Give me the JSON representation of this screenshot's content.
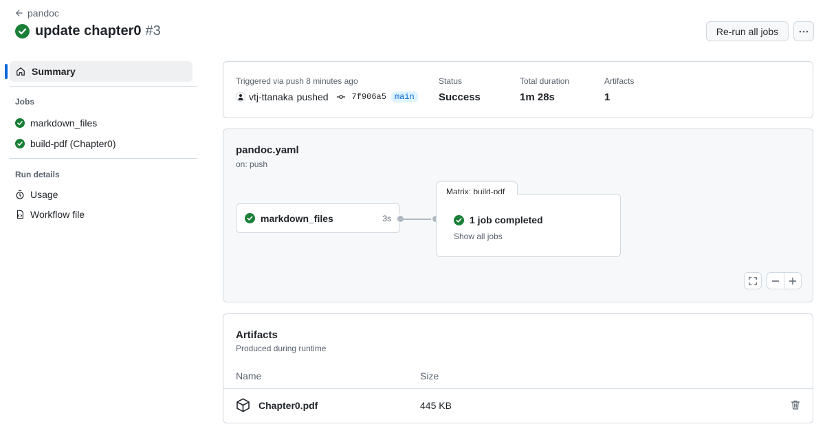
{
  "header": {
    "back_label": "pandoc",
    "run_title": "update chapter0",
    "run_number": "#3",
    "rerun_label": "Re-run all jobs",
    "more_icon": "kebab-horizontal-icon"
  },
  "sidebar": {
    "summary_label": "Summary",
    "jobs_heading": "Jobs",
    "jobs": [
      {
        "label": "markdown_files"
      },
      {
        "label": "build-pdf (Chapter0)"
      }
    ],
    "run_details_heading": "Run details",
    "run_details": [
      {
        "label": "Usage",
        "icon": "stopwatch-icon"
      },
      {
        "label": "Workflow file",
        "icon": "file-code-icon"
      }
    ]
  },
  "summary": {
    "trigger_label": "Triggered via push 8 minutes ago",
    "actor": "vtj-ttanaka",
    "action": "pushed",
    "commit": "7f906a5",
    "branch": "main",
    "status_label": "Status",
    "status_value": "Success",
    "duration_label": "Total duration",
    "duration_value": "1m 28s",
    "artifacts_label": "Artifacts",
    "artifacts_value": "1"
  },
  "workflow": {
    "name": "pandoc.yaml",
    "trigger": "on: push",
    "job": {
      "label": "markdown_files",
      "duration": "3s"
    },
    "matrix": {
      "tab_label": "Matrix: build-pdf",
      "summary": "1 job completed",
      "show_all": "Show all jobs"
    }
  },
  "artifacts": {
    "title": "Artifacts",
    "subtitle": "Produced during runtime",
    "columns": {
      "name": "Name",
      "size": "Size"
    },
    "rows": [
      {
        "name": "Chapter0.pdf",
        "size": "445 KB"
      }
    ]
  },
  "colors": {
    "success": "#1a7f37",
    "accent": "#0969da",
    "border": "#d1d9e0",
    "muted": "#59636e"
  }
}
